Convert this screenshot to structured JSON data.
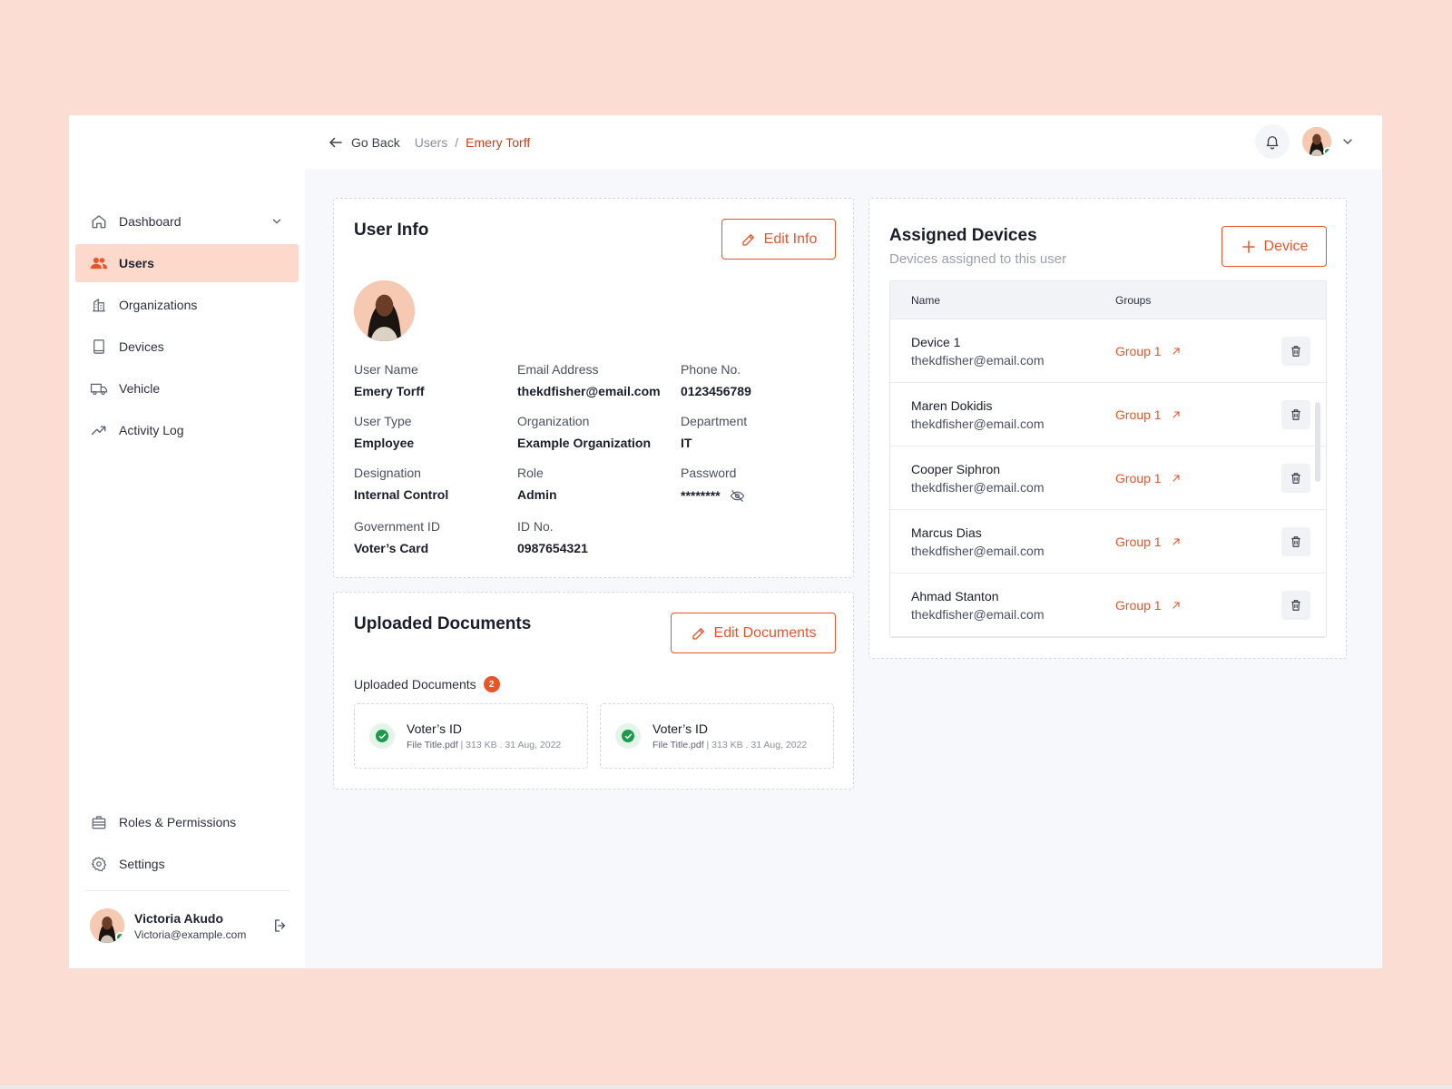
{
  "colors": {
    "accent": "#E8552B",
    "accent_light": "#FDD9CC",
    "online": "#1e9b4a",
    "background": "#FCDDD3"
  },
  "sidebar": {
    "items": [
      {
        "label": "Dashboard",
        "icon": "home-icon"
      },
      {
        "label": "Users",
        "icon": "users-icon",
        "active": true
      },
      {
        "label": "Organizations",
        "icon": "building-icon"
      },
      {
        "label": "Devices",
        "icon": "tablet-icon"
      },
      {
        "label": "Vehicle",
        "icon": "truck-icon"
      },
      {
        "label": "Activity Log",
        "icon": "trend-icon"
      }
    ],
    "bottom_items": [
      {
        "label": "Roles & Permissions",
        "icon": "briefcase-icon"
      },
      {
        "label": "Settings",
        "icon": "gear-icon"
      }
    ],
    "user": {
      "name": "Victoria Akudo",
      "email": "Victoria@example.com"
    }
  },
  "topbar": {
    "back_label": "Go Back",
    "breadcrumb": {
      "parent": "Users",
      "separator": "/",
      "current": "Emery Torff"
    }
  },
  "user_info": {
    "title": "User Info",
    "edit_label": "Edit Info",
    "fields": [
      {
        "label": "User Name",
        "value": "Emery Torff"
      },
      {
        "label": "Email Address",
        "value": "thekdfisher@email.com"
      },
      {
        "label": "Phone No.",
        "value": "0123456789"
      },
      {
        "label": "User Type",
        "value": "Employee"
      },
      {
        "label": "Organization",
        "value": "Example Organization"
      },
      {
        "label": "Department",
        "value": "IT"
      },
      {
        "label": "Designation",
        "value": "Internal Control"
      },
      {
        "label": "Role",
        "value": "Admin"
      },
      {
        "label": "Password",
        "value": "********"
      },
      {
        "label": "Government ID",
        "value": "Voter’s Card"
      },
      {
        "label": "ID No.",
        "value": "0987654321"
      }
    ]
  },
  "documents": {
    "title": "Uploaded Documents",
    "edit_label": "Edit Documents",
    "list_label": "Uploaded Documents",
    "count": "2",
    "items": [
      {
        "name": "Voter’s ID",
        "file": "File Title.pdf",
        "meta": "313 KB . 31 Aug, 2022"
      },
      {
        "name": "Voter’s ID",
        "file": "File Title.pdf",
        "meta": "313 KB . 31 Aug, 2022"
      }
    ]
  },
  "devices": {
    "title": "Assigned Devices",
    "subtitle": "Devices assigned to this user",
    "add_label": "Device",
    "columns": {
      "name": "Name",
      "groups": "Groups"
    },
    "rows": [
      {
        "name": "Device 1",
        "email": "thekdfisher@email.com",
        "group": "Group 1"
      },
      {
        "name": "Maren Dokidis",
        "email": "thekdfisher@email.com",
        "group": "Group 1"
      },
      {
        "name": "Cooper Siphron",
        "email": "thekdfisher@email.com",
        "group": "Group 1"
      },
      {
        "name": "Marcus Dias",
        "email": "thekdfisher@email.com",
        "group": "Group 1"
      },
      {
        "name": "Ahmad Stanton",
        "email": "thekdfisher@email.com",
        "group": "Group 1"
      }
    ]
  }
}
